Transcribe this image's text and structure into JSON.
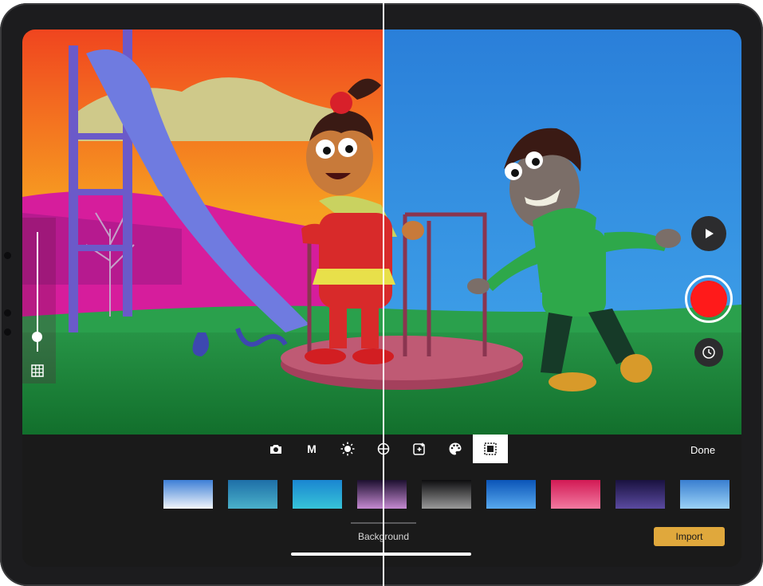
{
  "tools": [
    {
      "name": "camera-icon"
    },
    {
      "name": "manual-mode",
      "label": "M"
    },
    {
      "name": "brightness-icon"
    },
    {
      "name": "focus-icon"
    },
    {
      "name": "overlay-add-icon"
    },
    {
      "name": "palette-icon"
    },
    {
      "name": "background-icon",
      "active": true
    }
  ],
  "toolbar": {
    "done_label": "Done",
    "section_label": "Background",
    "import_label": "Import"
  },
  "backgrounds": [
    {
      "name": "clouds-sky",
      "colors": [
        "#3d7fd6",
        "#f2f6fb"
      ]
    },
    {
      "name": "coral-reef",
      "colors": [
        "#1e6fa8",
        "#4ab1c9"
      ]
    },
    {
      "name": "tropical-sea",
      "colors": [
        "#1a86d1",
        "#37c4d8"
      ]
    },
    {
      "name": "planet-horizon",
      "colors": [
        "#1d1030",
        "#c58ad1"
      ]
    },
    {
      "name": "moon-surface",
      "colors": [
        "#0d0d0f",
        "#9a9a9a"
      ]
    },
    {
      "name": "blue-gradient",
      "colors": [
        "#0b55b8",
        "#58a9ee"
      ]
    },
    {
      "name": "pink-bokeh",
      "colors": [
        "#d21a55",
        "#f27aa0"
      ]
    },
    {
      "name": "nebula",
      "colors": [
        "#1a1240",
        "#5a4aa0"
      ]
    },
    {
      "name": "blue-sparkle",
      "colors": [
        "#3a7fd0",
        "#9bd2f6"
      ]
    }
  ],
  "exposure_level": 0.13,
  "colors": {
    "record": "#ff1a1a",
    "import": "#e0a83c",
    "sky_left": "#f58a1c",
    "sky_right": "#2f8fe0",
    "grass": "#1e8a3a"
  }
}
